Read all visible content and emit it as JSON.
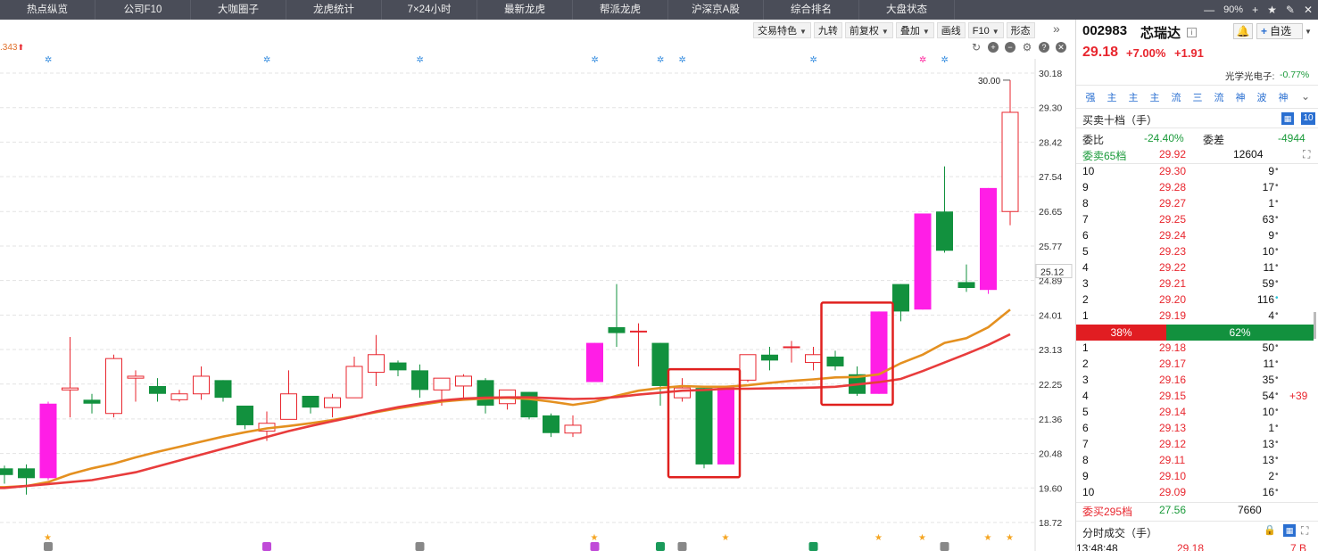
{
  "nav": {
    "tabs": [
      "热点纵览",
      "公司F10",
      "大咖圈子",
      "龙虎统计",
      "7×24小时",
      "最新龙虎",
      "帮派龙虎",
      "沪深京A股",
      "综合排名",
      "大盘状态"
    ],
    "zoom": "90%"
  },
  "toolbar": {
    "buttons": [
      {
        "label": "交易特色",
        "dropdown": true
      },
      {
        "label": "九转",
        "dropdown": false
      },
      {
        "label": "前复权",
        "dropdown": true
      },
      {
        "label": "叠加",
        "dropdown": true
      },
      {
        "label": "画线",
        "dropdown": false
      },
      {
        "label": "F10",
        "dropdown": true
      },
      {
        "label": "形态",
        "dropdown": false
      }
    ]
  },
  "chart_ma_label": ".343",
  "chart_data": {
    "type": "candlestick",
    "y_ticks": [
      30.18,
      29.3,
      28.42,
      27.54,
      26.65,
      25.77,
      24.89,
      24.01,
      23.13,
      22.25,
      21.36,
      20.48,
      19.6,
      18.72
    ],
    "ylim": [
      18.72,
      30.18
    ],
    "current_price_marker": 25.12,
    "high_label": "30.00",
    "candles": [
      {
        "o": 19.93,
        "h": 20.17,
        "l": 19.71,
        "c": 20.1,
        "color": "green"
      },
      {
        "o": 20.1,
        "h": 20.2,
        "l": 19.43,
        "c": 19.85,
        "color": "green"
      },
      {
        "o": 19.85,
        "h": 21.8,
        "l": 19.8,
        "c": 21.75,
        "color": "magenta"
      },
      {
        "o": 22.1,
        "h": 23.45,
        "l": 21.4,
        "c": 22.15,
        "color": "red"
      },
      {
        "o": 21.85,
        "h": 22.0,
        "l": 21.5,
        "c": 21.75,
        "color": "green"
      },
      {
        "o": 21.5,
        "h": 23.0,
        "l": 21.4,
        "c": 22.9,
        "color": "red"
      },
      {
        "o": 22.45,
        "h": 22.6,
        "l": 21.8,
        "c": 22.4,
        "color": "red"
      },
      {
        "o": 22.2,
        "h": 22.4,
        "l": 21.8,
        "c": 22.0,
        "color": "green"
      },
      {
        "o": 21.85,
        "h": 22.1,
        "l": 21.8,
        "c": 22.0,
        "color": "red"
      },
      {
        "o": 22.0,
        "h": 22.7,
        "l": 21.85,
        "c": 22.45,
        "color": "red"
      },
      {
        "o": 22.35,
        "h": 22.35,
        "l": 21.8,
        "c": 21.9,
        "color": "green"
      },
      {
        "o": 21.7,
        "h": 21.7,
        "l": 21.1,
        "c": 21.2,
        "color": "green"
      },
      {
        "o": 21.05,
        "h": 21.55,
        "l": 20.8,
        "c": 21.25,
        "color": "red"
      },
      {
        "o": 21.35,
        "h": 22.6,
        "l": 21.35,
        "c": 22.0,
        "color": "red"
      },
      {
        "o": 21.95,
        "h": 21.95,
        "l": 21.5,
        "c": 21.65,
        "color": "green"
      },
      {
        "o": 21.65,
        "h": 22.0,
        "l": 21.4,
        "c": 21.9,
        "color": "red"
      },
      {
        "o": 21.9,
        "h": 22.95,
        "l": 21.9,
        "c": 22.7,
        "color": "red"
      },
      {
        "o": 22.55,
        "h": 23.5,
        "l": 22.2,
        "c": 23.0,
        "color": "red"
      },
      {
        "o": 22.8,
        "h": 22.85,
        "l": 22.45,
        "c": 22.6,
        "color": "green"
      },
      {
        "o": 22.6,
        "h": 22.75,
        "l": 21.9,
        "c": 22.1,
        "color": "green"
      },
      {
        "o": 22.1,
        "h": 22.4,
        "l": 21.7,
        "c": 22.4,
        "color": "red"
      },
      {
        "o": 22.2,
        "h": 22.5,
        "l": 21.9,
        "c": 22.45,
        "color": "red"
      },
      {
        "o": 22.35,
        "h": 22.4,
        "l": 21.5,
        "c": 21.7,
        "color": "green"
      },
      {
        "o": 21.75,
        "h": 22.1,
        "l": 21.6,
        "c": 22.1,
        "color": "red"
      },
      {
        "o": 22.05,
        "h": 22.05,
        "l": 21.35,
        "c": 21.4,
        "color": "green"
      },
      {
        "o": 21.45,
        "h": 21.5,
        "l": 20.9,
        "c": 21.0,
        "color": "green"
      },
      {
        "o": 21.0,
        "h": 21.45,
        "l": 20.9,
        "c": 21.2,
        "color": "red"
      },
      {
        "o": 22.3,
        "h": 23.3,
        "l": 22.3,
        "c": 23.3,
        "color": "magenta"
      },
      {
        "o": 23.7,
        "h": 24.8,
        "l": 23.2,
        "c": 23.55,
        "color": "green"
      },
      {
        "o": 23.6,
        "h": 23.8,
        "l": 22.7,
        "c": 23.6,
        "color": "red"
      },
      {
        "o": 23.3,
        "h": 23.3,
        "l": 21.7,
        "c": 22.2,
        "color": "green"
      },
      {
        "o": 21.9,
        "h": 22.4,
        "l": 21.8,
        "c": 22.15,
        "color": "red"
      },
      {
        "o": 22.15,
        "h": 22.15,
        "l": 20.1,
        "c": 20.2,
        "color": "green"
      },
      {
        "o": 20.2,
        "h": 22.2,
        "l": 20.2,
        "c": 22.2,
        "color": "magenta"
      },
      {
        "o": 22.35,
        "h": 23.0,
        "l": 22.3,
        "c": 23.0,
        "color": "red"
      },
      {
        "o": 23.0,
        "h": 23.2,
        "l": 22.6,
        "c": 22.85,
        "color": "green"
      },
      {
        "o": 23.2,
        "h": 23.35,
        "l": 22.8,
        "c": 23.2,
        "color": "red"
      },
      {
        "o": 22.8,
        "h": 23.2,
        "l": 22.6,
        "c": 23.0,
        "color": "red"
      },
      {
        "o": 22.95,
        "h": 23.1,
        "l": 22.6,
        "c": 22.7,
        "color": "green"
      },
      {
        "o": 22.5,
        "h": 22.7,
        "l": 21.95,
        "c": 22.0,
        "color": "green"
      },
      {
        "o": 22.0,
        "h": 24.1,
        "l": 22.0,
        "c": 24.1,
        "color": "magenta"
      },
      {
        "o": 24.1,
        "h": 24.8,
        "l": 23.85,
        "c": 24.8,
        "color": "green"
      },
      {
        "o": 24.15,
        "h": 26.6,
        "l": 24.15,
        "c": 26.6,
        "color": "magenta"
      },
      {
        "o": 26.65,
        "h": 27.8,
        "l": 25.6,
        "c": 25.65,
        "color": "green"
      },
      {
        "o": 24.85,
        "h": 25.3,
        "l": 24.6,
        "c": 24.7,
        "color": "green"
      },
      {
        "o": 24.65,
        "h": 27.25,
        "l": 24.55,
        "c": 27.25,
        "color": "magenta"
      },
      {
        "o": 26.65,
        "h": 30.0,
        "l": 26.3,
        "c": 29.18,
        "color": "red"
      }
    ],
    "ma_orange": [
      19.62,
      19.65,
      19.75,
      19.95,
      20.1,
      20.22,
      20.38,
      20.52,
      20.65,
      20.78,
      20.91,
      21.02,
      21.12,
      21.18,
      21.25,
      21.33,
      21.43,
      21.53,
      21.63,
      21.72,
      21.8,
      21.85,
      21.88,
      21.9,
      21.87,
      21.8,
      21.72,
      21.8,
      21.95,
      22.08,
      22.15,
      22.2,
      22.18,
      22.18,
      22.22,
      22.28,
      22.33,
      22.37,
      22.42,
      22.43,
      22.5,
      22.78,
      23.0,
      23.3,
      23.42,
      23.7,
      24.15
    ],
    "ma_red": [
      19.6,
      19.65,
      19.7,
      19.75,
      19.8,
      19.9,
      20.0,
      20.15,
      20.3,
      20.45,
      20.6,
      20.75,
      20.9,
      21.05,
      21.18,
      21.3,
      21.42,
      21.55,
      21.66,
      21.75,
      21.83,
      21.88,
      21.9,
      21.91,
      21.91,
      21.89,
      21.87,
      21.88,
      21.92,
      21.98,
      22.03,
      22.08,
      22.1,
      22.13,
      22.13,
      22.14,
      22.15,
      22.16,
      22.18,
      22.24,
      22.3,
      22.38,
      22.58,
      22.8,
      23.02,
      23.25,
      23.52
    ],
    "signal_marks_top": [
      2,
      12,
      19,
      27,
      30,
      31,
      37,
      42,
      43
    ],
    "boxes": [
      [
        31,
        33
      ],
      [
        38,
        40
      ]
    ]
  },
  "stock": {
    "code": "002983",
    "name": "芯瑞达",
    "price": "29.18",
    "pct": "+7.00%",
    "chg": "+1.91",
    "industry": "光学光电子:",
    "industry_chg": "-0.77%",
    "watch_label": "自选"
  },
  "tags": [
    "强",
    "主",
    "主",
    "主",
    "流",
    "三",
    "流",
    "神",
    "波",
    "神"
  ],
  "orderbook": {
    "title": "买卖十档（手）",
    "weibi_label": "委比",
    "weibi_val": "-24.40%",
    "weicha_label": "委差",
    "weicha_val": "-4944",
    "sell_header": {
      "label": "委卖65档",
      "price": "29.92",
      "volume": "12604"
    },
    "asks": [
      {
        "level": "10",
        "price": "29.30",
        "volume": "9"
      },
      {
        "level": "9",
        "price": "29.28",
        "volume": "17"
      },
      {
        "level": "8",
        "price": "29.27",
        "volume": "1"
      },
      {
        "level": "7",
        "price": "29.25",
        "volume": "63"
      },
      {
        "level": "6",
        "price": "29.24",
        "volume": "9"
      },
      {
        "level": "5",
        "price": "29.23",
        "volume": "10"
      },
      {
        "level": "4",
        "price": "29.22",
        "volume": "11"
      },
      {
        "level": "3",
        "price": "29.21",
        "volume": "59"
      },
      {
        "level": "2",
        "price": "29.20",
        "volume": "116"
      },
      {
        "level": "1",
        "price": "29.19",
        "volume": "4"
      }
    ],
    "ratio_red": "38%",
    "ratio_green": "62%",
    "bids": [
      {
        "level": "1",
        "price": "29.18",
        "volume": "50",
        "extra": ""
      },
      {
        "level": "2",
        "price": "29.17",
        "volume": "11",
        "extra": ""
      },
      {
        "level": "3",
        "price": "29.16",
        "volume": "35",
        "extra": ""
      },
      {
        "level": "4",
        "price": "29.15",
        "volume": "54",
        "extra": "+39"
      },
      {
        "level": "5",
        "price": "29.14",
        "volume": "10",
        "extra": ""
      },
      {
        "level": "6",
        "price": "29.13",
        "volume": "1",
        "extra": ""
      },
      {
        "level": "7",
        "price": "29.12",
        "volume": "13",
        "extra": ""
      },
      {
        "level": "8",
        "price": "29.11",
        "volume": "13",
        "extra": ""
      },
      {
        "level": "9",
        "price": "29.10",
        "volume": "2",
        "extra": ""
      },
      {
        "level": "10",
        "price": "29.09",
        "volume": "16",
        "extra": ""
      }
    ],
    "buy_header": {
      "label": "委买295档",
      "price": "27.56",
      "volume": "7660"
    }
  },
  "timesales": {
    "title": "分时成交（手）",
    "row": {
      "time": "13:48:48",
      "price": "29.18",
      "volume": "7 B"
    }
  },
  "colors": {
    "up": "#e8262e",
    "down": "#12913e",
    "limit_up": "#ff1ee6",
    "ma_orange": "#e49020",
    "ma_red": "#e83c3c",
    "box": "#e0201e"
  }
}
